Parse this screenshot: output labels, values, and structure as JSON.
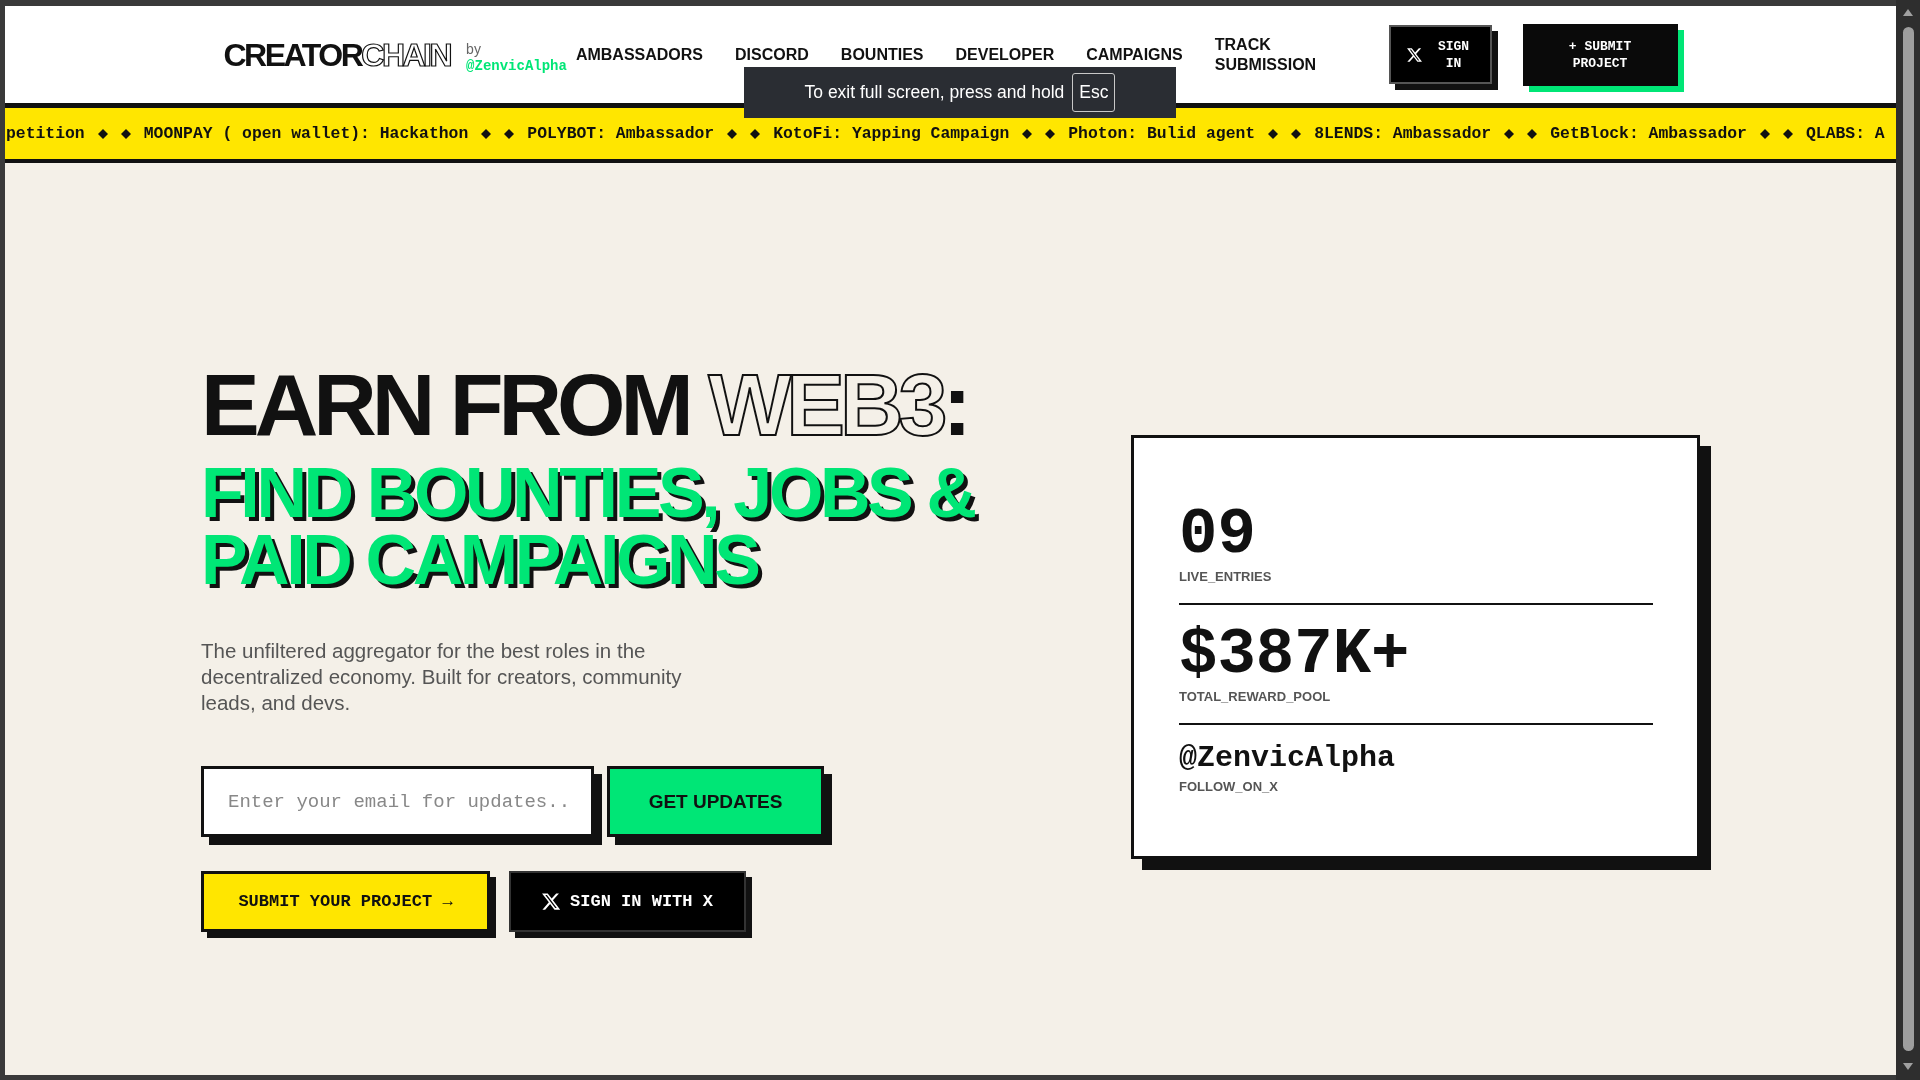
{
  "header": {
    "logo": [
      {
        "text": "CREATOR",
        "kind": "solid"
      },
      {
        "text": "CHAIN",
        "kind": "outline"
      }
    ],
    "byline": "by",
    "handle": "@ZenvicAlpha",
    "nav": [
      "AMBASSADORS",
      "DISCORD",
      "BOUNTIES",
      "DEVELOPER",
      "CAMPAIGNS",
      "TRACK SUBMISSION"
    ],
    "sign_in_button": "SIGN IN",
    "submit_button": "+ SUBMIT PROJECT"
  },
  "fullscreen_notice": {
    "text": "To exit full screen, press and hold",
    "key": "Esc"
  },
  "ticker": [
    "petition",
    "MOONPAY ( open wallet): Hackathon",
    "POLYBOT: Ambassador",
    "KotoFi: Yapping Campaign",
    "Photon: Bulid agent",
    "8LENDS: Ambassador",
    "GetBlock: Ambassador",
    "QLABS: A"
  ],
  "hero": {
    "headline": [
      {
        "text": "EARN FROM ",
        "kind": "solid"
      },
      {
        "text": "WEB3",
        "kind": "outline"
      },
      {
        "text": ":",
        "kind": "solid"
      }
    ],
    "subheadline": "FIND BOUNTIES, JOBS & PAID CAMPAIGNS",
    "description": "The unfiltered aggregator for the best roles in the decentralized economy. Built for creators, community leads, and devs.",
    "email": {
      "placeholder": "Enter your email for updates.."
    },
    "get_updates_button": "GET UPDATES",
    "submit_project_button": "SUBMIT YOUR PROJECT →",
    "sign_in_x_button": "SIGN IN WITH X"
  },
  "stats": [
    {
      "value": "09",
      "label": "LIVE_ENTRIES",
      "kind": "number"
    },
    {
      "value": "$387K+",
      "label": "TOTAL_REWARD_POOL",
      "kind": "number"
    },
    {
      "value": "@ZenvicAlpha",
      "label": "FOLLOW_ON_X",
      "kind": "handle"
    }
  ]
}
